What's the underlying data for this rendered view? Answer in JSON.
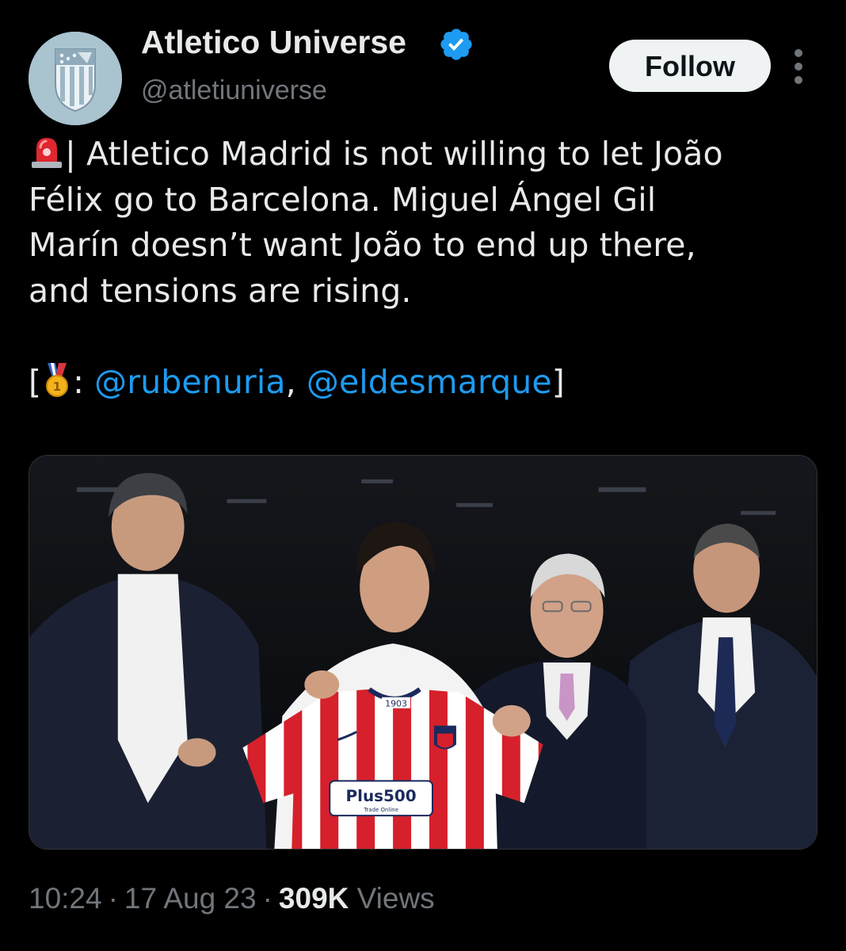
{
  "account": {
    "display_name": "Atletico Universe",
    "handle": "@atletiuniverse",
    "verified": true,
    "avatar_icon": "atletico-crest-icon"
  },
  "actions": {
    "follow_label": "Follow",
    "more_icon": "more-vertical-icon"
  },
  "tweet": {
    "emoji_siren": "siren-emoji-icon",
    "emoji_medal": "medal-emoji-icon",
    "line1": "| Atletico Madrid is not willing to let João",
    "line2": "Félix go to Barcelona. Miguel Ángel Gil",
    "line3": "Marín doesn’t want João to end up there,",
    "line4": "and tensions are rising.",
    "source_open": "[",
    "source_colon": ": ",
    "mention1": "@rubenuria",
    "source_comma": ", ",
    "mention2": "@eldesmarque",
    "source_close": "]"
  },
  "media": {
    "type": "photo",
    "jersey_year": "1903",
    "jersey_sponsor": "Plus500",
    "jersey_sponsor_sub": "Trade Online"
  },
  "meta": {
    "time": "10:24",
    "separator": "·",
    "date": "17 Aug 23",
    "views_count": "309K",
    "views_label": "Views"
  },
  "colors": {
    "background": "#000000",
    "text": "#e7e9ea",
    "secondary": "#71767b",
    "link": "#1d9bf0",
    "verified": "#1d9bf0",
    "follow_bg": "#eff3f4"
  }
}
